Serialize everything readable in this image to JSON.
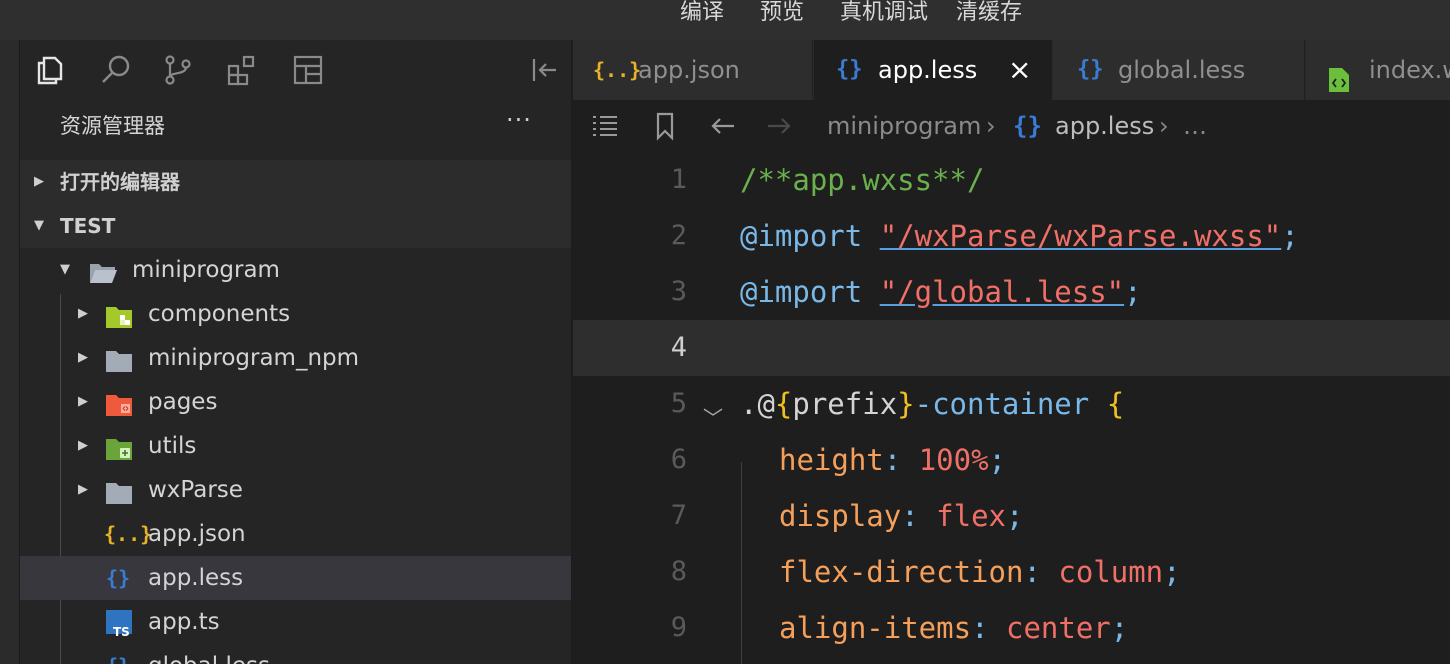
{
  "menu": {
    "compile": "编译",
    "preview": "预览",
    "debug": "真机调试",
    "clear_cache": "清缓存"
  },
  "activity_icons": [
    "files-icon",
    "search-icon",
    "source-control-icon",
    "extensions-icon",
    "layout-icon",
    "collapse-panel-icon"
  ],
  "explorer": {
    "title": "资源管理器",
    "more": "···",
    "section_open": "打开的编辑器",
    "section_project": "TEST",
    "tree": [
      {
        "name": "miniprogram",
        "type": "folder-open",
        "depth": 0
      },
      {
        "name": "components",
        "type": "folder-components",
        "depth": 1
      },
      {
        "name": "miniprogram_npm",
        "type": "folder",
        "depth": 1
      },
      {
        "name": "pages",
        "type": "folder-pages",
        "depth": 1
      },
      {
        "name": "utils",
        "type": "folder-utils",
        "depth": 1
      },
      {
        "name": "wxParse",
        "type": "folder",
        "depth": 1
      },
      {
        "name": "app.json",
        "type": "json",
        "depth": 1
      },
      {
        "name": "app.less",
        "type": "less",
        "depth": 1,
        "selected": true
      },
      {
        "name": "app.ts",
        "type": "ts",
        "depth": 1
      },
      {
        "name": "global.less",
        "type": "less",
        "depth": 1
      }
    ]
  },
  "tabs": [
    {
      "icon": "{..}",
      "label": "app.json",
      "active": false
    },
    {
      "icon": "{}",
      "label": "app.less",
      "active": true,
      "close": "×"
    },
    {
      "icon": "{}",
      "label": "global.less",
      "active": false
    },
    {
      "icon": "file-code-icon",
      "label": "index.w",
      "active": false
    }
  ],
  "breadcrumbs": {
    "folder": "miniprogram",
    "sep": "›",
    "file_icon": "{}",
    "file": "app.less",
    "ellipsis": "…"
  },
  "code": {
    "lines": [
      "1",
      "2",
      "3",
      "4",
      "5",
      "6",
      "7",
      "8",
      "9"
    ],
    "current_line": "4",
    "l1": "/**app.wxss**/",
    "l2_kw": "@import",
    "l2_str": "\"/wxParse/wxParse.wxss\"",
    "l2_end": ";",
    "l3_kw": "@import",
    "l3_str": "\"/global.less\"",
    "l3_end": ";",
    "l5_dot": ".@",
    "l5_ob": "{",
    "l5_var": "prefix",
    "l5_cb": "}",
    "l5_rest": "-container",
    "l5_brace": "{",
    "l6_prop": "height",
    "l6_colon": ":",
    "l6_val": "100%",
    "l6_end": ";",
    "l7_prop": "display",
    "l7_colon": ":",
    "l7_val": "flex",
    "l7_end": ";",
    "l8_prop": "flex-direction",
    "l8_colon": ":",
    "l8_val": "column",
    "l8_end": ";",
    "l9_prop": "align-items",
    "l9_colon": ":",
    "l9_val": "center",
    "l9_end": ";"
  },
  "colors": {
    "comment": "#6ab04c",
    "keyword": "#7ab8e8",
    "string": "#f07068",
    "brace": "#f0c020",
    "property": "#f5a05a"
  }
}
